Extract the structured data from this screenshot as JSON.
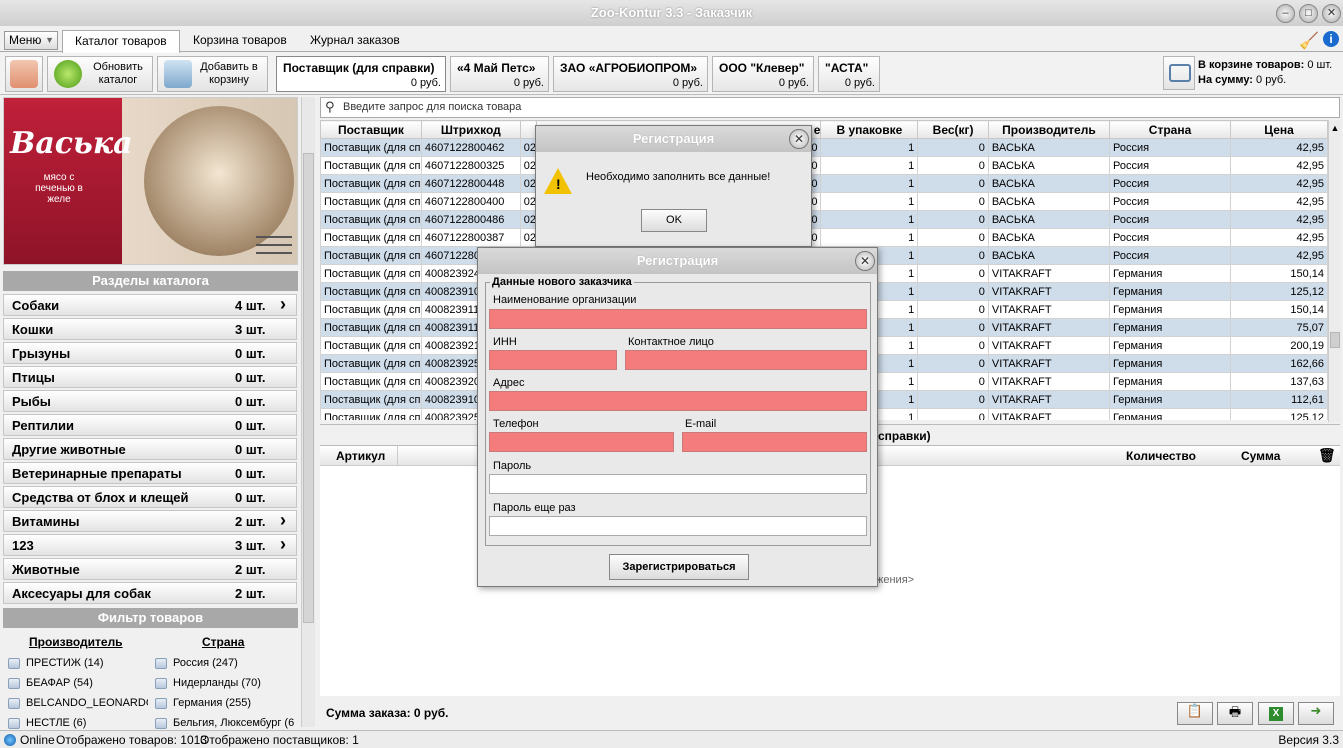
{
  "window": {
    "title": "Zoo-Kontur 3.3 - Заказчик"
  },
  "menu": {
    "label": "Меню"
  },
  "tabs": [
    "Каталог товаров",
    "Корзина товаров",
    "Журнал заказов"
  ],
  "toolbar": {
    "refresh": "Обновить каталог",
    "add_to_cart": "Добавить в корзину"
  },
  "suppliers": [
    {
      "name": "Поставщик (для справки)",
      "sum": "0 руб."
    },
    {
      "name": "«4 Май Петс»",
      "sum": "0 руб."
    },
    {
      "name": "ЗАО «АГРОБИОПРОМ»",
      "sum": "0 руб."
    },
    {
      "name": "ООО \"Клевер\"",
      "sum": "0 руб."
    },
    {
      "name": "\"АСТА\"",
      "sum": "0 руб."
    }
  ],
  "cart": {
    "items_label": "В корзине товаров:",
    "items_value": "0 шт.",
    "sum_label": "На сумму:",
    "sum_value": "0 руб."
  },
  "catalog": {
    "header": "Разделы каталога",
    "items": [
      {
        "name": "Собаки",
        "count": "4 шт.",
        "arrow": true
      },
      {
        "name": "Кошки",
        "count": "3 шт.",
        "arrow": false
      },
      {
        "name": "Грызуны",
        "count": "0 шт.",
        "arrow": false
      },
      {
        "name": "Птицы",
        "count": "0 шт.",
        "arrow": false
      },
      {
        "name": "Рыбы",
        "count": "0 шт.",
        "arrow": false
      },
      {
        "name": "Рептилии",
        "count": "0 шт.",
        "arrow": false
      },
      {
        "name": "Другие животные",
        "count": "0 шт.",
        "arrow": false
      },
      {
        "name": "Ветеринарные препараты",
        "count": "0 шт.",
        "arrow": false
      },
      {
        "name": "Средства от блох и клещей",
        "count": "0 шт.",
        "arrow": false
      },
      {
        "name": "Витамины",
        "count": "2 шт.",
        "arrow": true
      },
      {
        "name": "123",
        "count": "3 шт.",
        "arrow": true
      },
      {
        "name": "Животные",
        "count": "2 шт.",
        "arrow": false
      },
      {
        "name": "Аксесуары для собак",
        "count": "2 шт.",
        "arrow": false
      }
    ]
  },
  "product_image": {
    "brand": "Васька",
    "text": "мясо с печенью в желе"
  },
  "filter": {
    "header": "Фильтр товаров",
    "manufacturer_label": "Производитель",
    "country_label": "Страна",
    "manufacturers": [
      "ПРЕСТИЖ (14)",
      "БЕАФАР (54)",
      "BELCANDO_LEONARDO (",
      "НЕСТЛЕ (6)"
    ],
    "countries": [
      "Россия (247)",
      "Нидерланды (70)",
      "Германия (255)",
      "Бельгия, Люксембург (6"
    ]
  },
  "search": {
    "placeholder": "Введите запрос для поиска товара"
  },
  "grid": {
    "columns": [
      "Поставщик",
      "Штрихкод",
      "",
      "е",
      "В упаковке",
      "Вес(кг)",
      "Производитель",
      "Страна",
      "Цена"
    ],
    "rows": [
      [
        "Поставщик (для сп",
        "4607122800462",
        "02",
        "0",
        "1",
        "0",
        "ВАСЬКА",
        "Россия",
        "42,95"
      ],
      [
        "Поставщик (для сп",
        "4607122800325",
        "02",
        "0",
        "1",
        "0",
        "ВАСЬКА",
        "Россия",
        "42,95"
      ],
      [
        "Поставщик (для сп",
        "4607122800448",
        "02",
        "0",
        "1",
        "0",
        "ВАСЬКА",
        "Россия",
        "42,95"
      ],
      [
        "Поставщик (для сп",
        "4607122800400",
        "02",
        "0",
        "1",
        "0",
        "ВАСЬКА",
        "Россия",
        "42,95"
      ],
      [
        "Поставщик (для сп",
        "4607122800486",
        "02",
        "0",
        "1",
        "0",
        "ВАСЬКА",
        "Россия",
        "42,95"
      ],
      [
        "Поставщик (для сп",
        "4607122800387",
        "02",
        "0",
        "1",
        "0",
        "ВАСЬКА",
        "Россия",
        "42,95"
      ],
      [
        "Поставщик (для сп",
        "460712280",
        "",
        "",
        "1",
        "0",
        "ВАСЬКА",
        "Россия",
        "42,95"
      ],
      [
        "Поставщик (для сп",
        "400823924",
        "",
        "",
        "1",
        "0",
        "VITAKRAFT",
        "Германия",
        "150,14"
      ],
      [
        "Поставщик (для сп",
        "400823910",
        "",
        "",
        "1",
        "0",
        "VITAKRAFT",
        "Германия",
        "125,12"
      ],
      [
        "Поставщик (для сп",
        "400823911",
        "",
        "",
        "1",
        "0",
        "VITAKRAFT",
        "Германия",
        "150,14"
      ],
      [
        "Поставщик (для сп",
        "400823911",
        "",
        "",
        "1",
        "0",
        "VITAKRAFT",
        "Германия",
        "75,07"
      ],
      [
        "Поставщик (для сп",
        "400823921",
        "",
        "",
        "1",
        "0",
        "VITAKRAFT",
        "Германия",
        "200,19"
      ],
      [
        "Поставщик (для сп",
        "400823925",
        "",
        "",
        "1",
        "0",
        "VITAKRAFT",
        "Германия",
        "162,66"
      ],
      [
        "Поставщик (для сп",
        "400823920",
        "",
        "",
        "1",
        "0",
        "VITAKRAFT",
        "Германия",
        "137,63"
      ],
      [
        "Поставщик (для сп",
        "400823910",
        "",
        "",
        "1",
        "0",
        "VITAKRAFT",
        "Германия",
        "112,61"
      ],
      [
        "Поставщик (для сп",
        "400823925",
        "",
        "",
        "1",
        "0",
        "VITAKRAFT",
        "Германия",
        "125,12"
      ]
    ]
  },
  "order": {
    "supplier_suffix": "справки)",
    "col_article": "Артикул",
    "col_qty": "Количество",
    "col_sum": "Сумма",
    "hint_tail": "жения>",
    "total": "Сумма заказа: 0 руб."
  },
  "status": {
    "online": "Online",
    "shown_goods": "Отображено товаров: 1013",
    "shown_suppliers": "Отображено поставщиков: 1",
    "version": "Версия 3.3"
  },
  "alert": {
    "title": "Регистрация",
    "message": "Необходимо заполнить все данные!",
    "ok": "OK"
  },
  "register": {
    "title": "Регистрация",
    "group": "Данные нового заказчика",
    "org_label": "Наименование организации",
    "inn_label": "ИНН",
    "contact_label": "Контактное лицо",
    "address_label": "Адрес",
    "phone_label": "Телефон",
    "email_label": "E-mail",
    "password_label": "Пароль",
    "password2_label": "Пароль еще раз",
    "submit": "Зарегистрироваться"
  }
}
